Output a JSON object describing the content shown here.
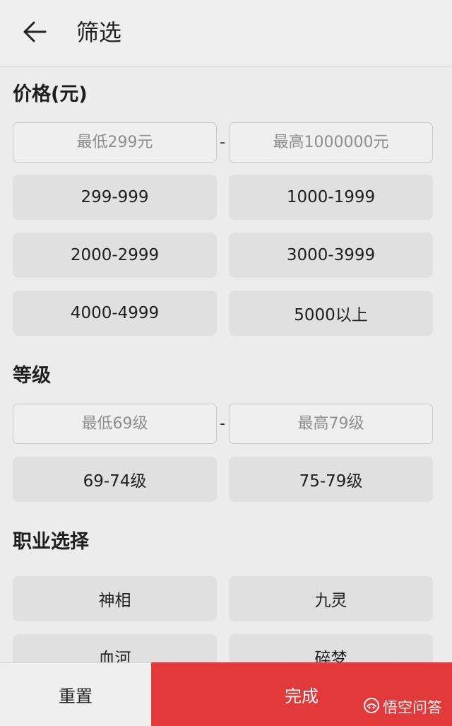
{
  "header": {
    "title": "筛选"
  },
  "price": {
    "title": "价格(元)",
    "min_placeholder": "最低299元",
    "max_placeholder": "最高1000000元",
    "separator": "-",
    "options": [
      "299-999",
      "1000-1999",
      "2000-2999",
      "3000-3999",
      "4000-4999",
      "5000以上"
    ]
  },
  "level": {
    "title": "等级",
    "min_placeholder": "最低69级",
    "max_placeholder": "最高79级",
    "separator": "-",
    "options": [
      "69-74级",
      "75-79级"
    ]
  },
  "profession": {
    "title": "职业选择",
    "options": [
      "神相",
      "九灵",
      "血河",
      "碎梦"
    ]
  },
  "footer": {
    "reset_label": "重置",
    "done_label": "完成"
  },
  "watermark": {
    "text": "悟空问答"
  },
  "colors": {
    "accent": "#e23a3a",
    "background": "#ececec",
    "chip": "#e0e0e0"
  }
}
